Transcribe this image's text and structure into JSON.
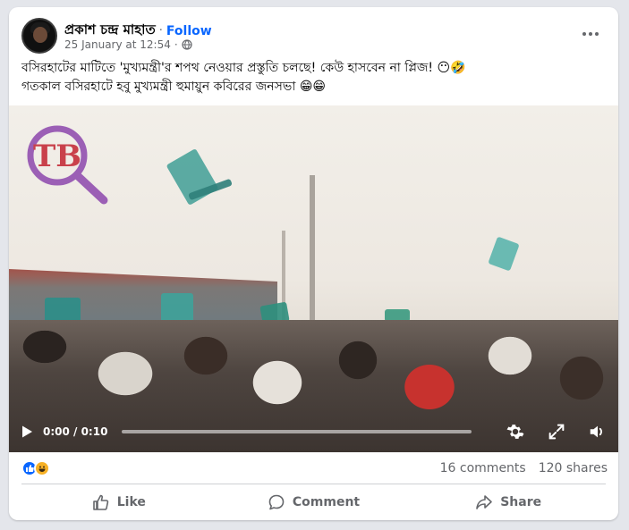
{
  "post": {
    "author": "প্রকাশ চন্দ্র মাহাত",
    "separator": "·",
    "follow_label": "Follow",
    "timestamp": "25 January at 12:54",
    "timestamp_separator": "·",
    "audience_icon": "globe-icon",
    "more_icon": "more-options-icon",
    "text_line1": "বসিরহাটের মাটিতে 'মুখ্যমন্ত্রী'র শপথ নেওয়ার প্রস্তুতি চলছে! কেউ হাসবেন না প্লিজ! 😶🤣",
    "text_line2": "গতকাল বসিরহাটে হবু মুখ্যমন্ত্রী হুমায়ুন কবিরের জনসভা 😁😁"
  },
  "video": {
    "time": "0:00 / 0:10",
    "progress": 0,
    "watermark_letters": "TB",
    "icons": [
      "play-icon",
      "settings-icon",
      "fullscreen-icon",
      "volume-icon"
    ]
  },
  "stats": {
    "reactions": [
      "like-reaction-icon",
      "haha-reaction-icon"
    ],
    "comments": "16 comments",
    "shares": "120 shares"
  },
  "actions": {
    "like": "Like",
    "comment": "Comment",
    "share": "Share"
  },
  "colors": {
    "link_blue": "#0866ff",
    "secondary_text": "#65676b",
    "background": "#e4e6eb",
    "watermark_purple": "#9b5fb5"
  }
}
